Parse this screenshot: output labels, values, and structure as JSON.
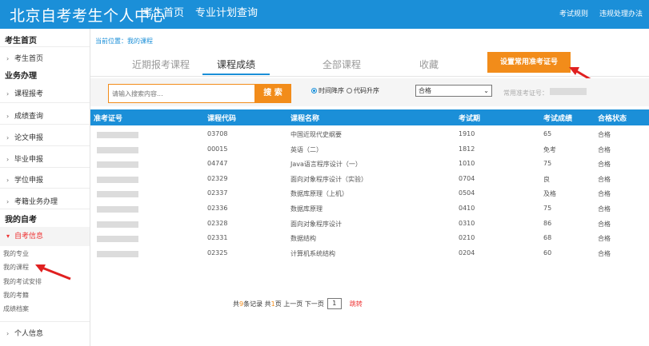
{
  "header": {
    "brand": "北京自考考生个人中心",
    "nav": [
      "考生首页",
      "专业计划查询"
    ],
    "right_links": [
      "考试规则",
      "违规处理办法"
    ]
  },
  "sidebar": {
    "home_head": "考生首页",
    "home_item": "考生首页",
    "biz_head": "业务办理",
    "biz_items": [
      "课程报考",
      "成绩查询",
      "论文申报",
      "毕业申报",
      "学位申报",
      "考籍业务办理"
    ],
    "my_head": "我的自考",
    "active_item": "自考信息",
    "sub_items": [
      "我的专业",
      "我的课程",
      "我的考试安排",
      "我的考籍",
      "成绩档案"
    ],
    "personal_item": "个人信息"
  },
  "breadcrumb": "当前位置：我的课程",
  "tabs": [
    "近期报考课程",
    "课程成绩",
    "全部课程",
    "收藏"
  ],
  "set_button": "设置常用准考证号",
  "search": {
    "placeholder": "请输入搜索内容...",
    "button": "搜 索"
  },
  "sort_options": [
    "时间降序",
    "代码升序"
  ],
  "status_select": "合格",
  "common_label": "常用准考证号：",
  "table": {
    "headers": [
      "准考证号",
      "课程代码",
      "课程名称",
      "考试期",
      "考试成绩",
      "合格状态"
    ],
    "rows": [
      {
        "code": "03708",
        "name": "中国近现代史纲要",
        "period": "1910",
        "score": "65",
        "status": "合格"
      },
      {
        "code": "00015",
        "name": "英语（二）",
        "period": "1812",
        "score": "免考",
        "status": "合格"
      },
      {
        "code": "04747",
        "name": "Java语言程序设计（一）",
        "period": "1010",
        "score": "75",
        "status": "合格"
      },
      {
        "code": "02329",
        "name": "面向对象程序设计（实验）",
        "period": "0704",
        "score": "良",
        "status": "合格"
      },
      {
        "code": "02337",
        "name": "数据库原理（上机）",
        "period": "0504",
        "score": "及格",
        "status": "合格"
      },
      {
        "code": "02336",
        "name": "数据库原理",
        "period": "0410",
        "score": "75",
        "status": "合格"
      },
      {
        "code": "02328",
        "name": "面向对象程序设计",
        "period": "0310",
        "score": "86",
        "status": "合格"
      },
      {
        "code": "02331",
        "name": "数据结构",
        "period": "0210",
        "score": "68",
        "status": "合格"
      },
      {
        "code": "02325",
        "name": "计算机系统结构",
        "period": "0204",
        "score": "60",
        "status": "合格"
      }
    ]
  },
  "pager": {
    "prefix": "共",
    "records": "9",
    "mid": "条记录 共",
    "pages": "1",
    "suffix": "页 上一页 下一页",
    "current": "1",
    "jump": "跳转"
  },
  "colors": {
    "primary": "#1b8fd8",
    "accent": "#f28c1a",
    "annotation": "#e02020"
  }
}
